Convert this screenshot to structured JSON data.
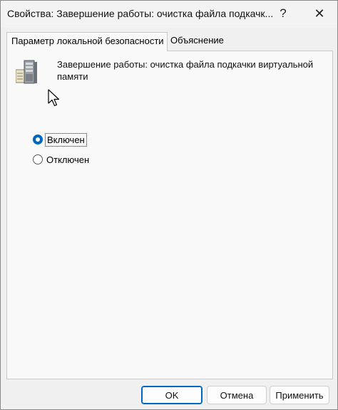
{
  "window": {
    "title": "Свойства: Завершение работы: очистка файла подкачк...",
    "help_glyph": "?",
    "close_glyph": "✕"
  },
  "tabs": [
    {
      "label": "Параметр локальной безопасности",
      "active": true
    },
    {
      "label": "Объяснение",
      "active": false
    }
  ],
  "policy": {
    "icon": "server-policy-icon",
    "title": "Завершение работы: очистка файла подкачки виртуальной памяти"
  },
  "options": [
    {
      "label": "Включен",
      "selected": true
    },
    {
      "label": "Отключен",
      "selected": false
    }
  ],
  "buttons": {
    "ok": "OK",
    "cancel": "Отмена",
    "apply": "Применить"
  },
  "colors": {
    "accent": "#0067c0"
  }
}
